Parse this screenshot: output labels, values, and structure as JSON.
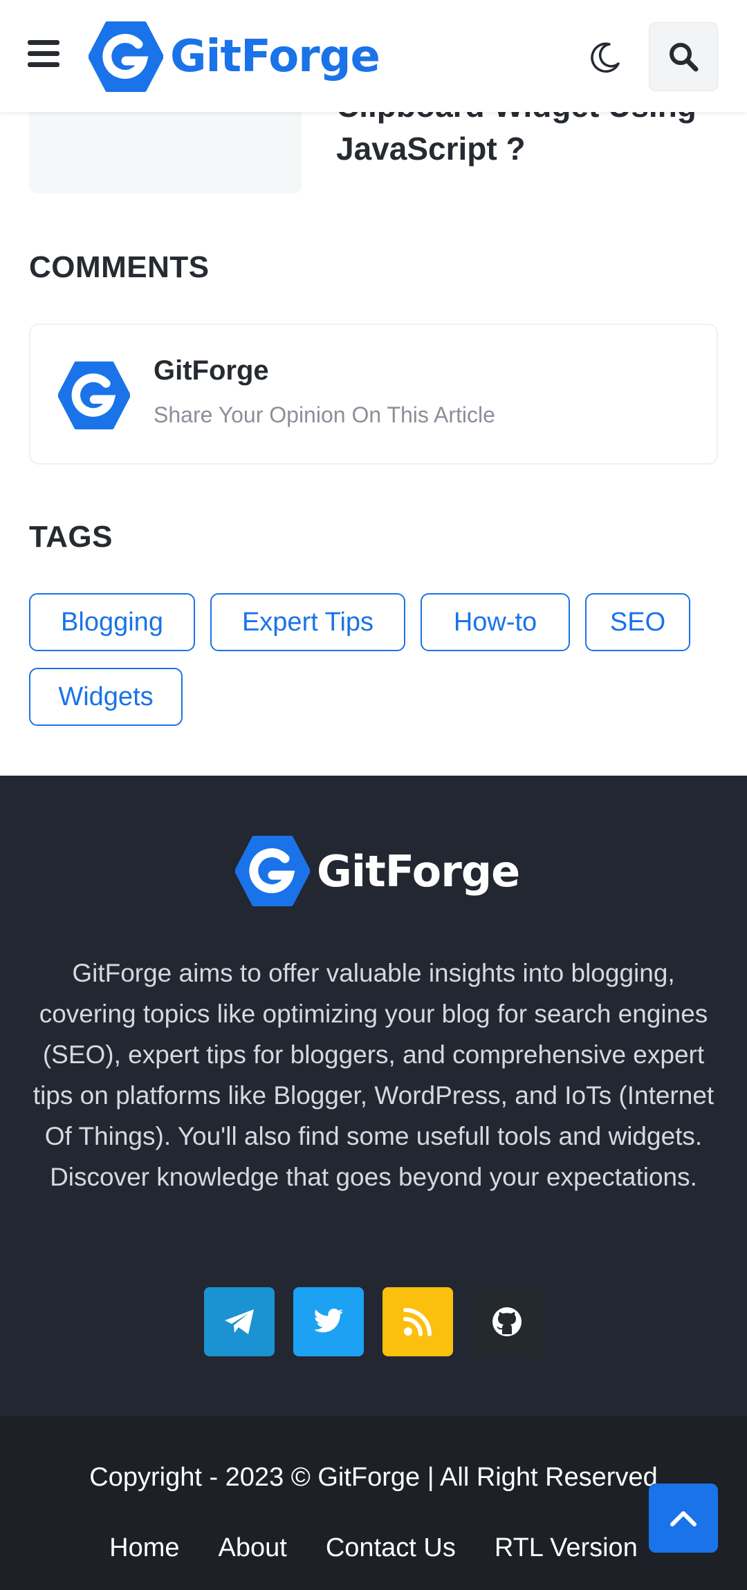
{
  "header": {
    "brand": "GitForge",
    "icons": {
      "menu": "hamburger-icon",
      "theme": "moon-icon",
      "search": "search-icon"
    }
  },
  "related_post": {
    "title_line1": "Clipboard Widget Using",
    "title_line2": "JavaScript ?"
  },
  "comments": {
    "heading": "COMMENTS",
    "author": "GitForge",
    "prompt": "Share Your Opinion On This Article"
  },
  "tags": {
    "heading": "TAGS",
    "items": [
      "Blogging",
      "Expert Tips",
      "How-to",
      "SEO",
      "Widgets"
    ]
  },
  "footer": {
    "brand": "GitForge",
    "description": "GitForge aims to offer valuable insights into blogging, covering topics like optimizing your blog for search engines (SEO), expert tips for bloggers, and comprehensive expert tips on platforms like Blogger, WordPress, and IoTs (Internet Of Things). You'll also find some usefull tools and widgets. Discover knowledge that goes beyond your expectations.",
    "social": [
      {
        "name": "telegram-icon",
        "color": "#1b92d1"
      },
      {
        "name": "twitter-icon",
        "color": "#1da1f2"
      },
      {
        "name": "rss-icon",
        "color": "#fbbf0e"
      },
      {
        "name": "github-icon",
        "color": "#24292e"
      }
    ],
    "copyright": "Copyright - 2023 © GitForge | All Right Reserved",
    "links": [
      "Home",
      "About",
      "Contact Us",
      "RTL Version"
    ]
  },
  "colors": {
    "accent": "#1a73e8",
    "footer_bg": "#232731",
    "bottom_bg": "#1d2027"
  }
}
